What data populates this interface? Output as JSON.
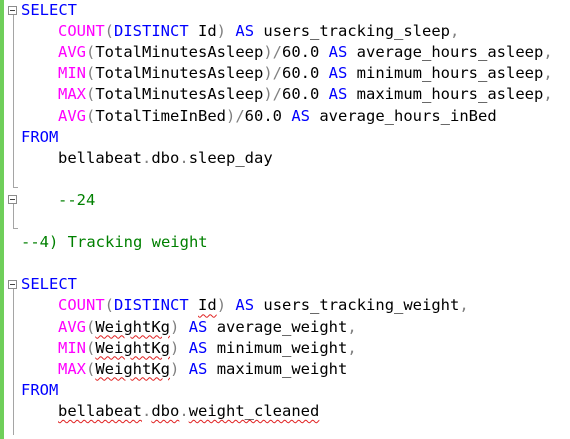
{
  "editor": {
    "lines": [
      {
        "t": [
          [
            "kw",
            "SELECT"
          ]
        ]
      },
      {
        "t": [
          [
            "fn",
            "COUNT"
          ],
          [
            "op",
            "("
          ],
          [
            "kw",
            "DISTINCT"
          ],
          [
            "tx",
            " Id"
          ],
          [
            "op",
            ")"
          ],
          [
            "tx",
            " "
          ],
          [
            "kw",
            "AS"
          ],
          [
            "tx",
            " users_tracking_sleep"
          ],
          [
            "op",
            ","
          ]
        ]
      },
      {
        "t": [
          [
            "fn",
            "AVG"
          ],
          [
            "op",
            "("
          ],
          [
            "tx",
            "TotalMinutesAsleep"
          ],
          [
            "op",
            ")/"
          ],
          [
            "tx",
            "60.0 "
          ],
          [
            "kw",
            "AS"
          ],
          [
            "tx",
            " average_hours_asleep"
          ],
          [
            "op",
            ","
          ]
        ]
      },
      {
        "t": [
          [
            "fn",
            "MIN"
          ],
          [
            "op",
            "("
          ],
          [
            "tx",
            "TotalMinutesAsleep"
          ],
          [
            "op",
            ")/"
          ],
          [
            "tx",
            "60.0 "
          ],
          [
            "kw",
            "AS"
          ],
          [
            "tx",
            " minimum_hours_asleep"
          ],
          [
            "op",
            ","
          ]
        ]
      },
      {
        "t": [
          [
            "fn",
            "MAX"
          ],
          [
            "op",
            "("
          ],
          [
            "tx",
            "TotalMinutesAsleep"
          ],
          [
            "op",
            ")/"
          ],
          [
            "tx",
            "60.0 "
          ],
          [
            "kw",
            "AS"
          ],
          [
            "tx",
            " maximum_hours_asleep"
          ],
          [
            "op",
            ","
          ]
        ]
      },
      {
        "t": [
          [
            "fn",
            "AVG"
          ],
          [
            "op",
            "("
          ],
          [
            "tx",
            "TotalTimeInBed"
          ],
          [
            "op",
            ")/"
          ],
          [
            "tx",
            "60.0 "
          ],
          [
            "kw",
            "AS"
          ],
          [
            "tx",
            " average_hours_inBed"
          ]
        ]
      },
      {
        "t": [
          [
            "kw",
            "FROM"
          ]
        ]
      },
      {
        "t": [
          [
            "tx",
            "bellabeat"
          ],
          [
            "op",
            "."
          ],
          [
            "tx",
            "dbo"
          ],
          [
            "op",
            "."
          ],
          [
            "tx",
            "sleep_day"
          ]
        ]
      },
      {
        "t": []
      },
      {
        "t": [
          [
            "cm",
            "--24"
          ]
        ]
      },
      {
        "t": []
      },
      {
        "t": [
          [
            "cm",
            "--4) Tracking weight"
          ]
        ]
      },
      {
        "t": []
      },
      {
        "t": [
          [
            "kw",
            "SELECT"
          ]
        ]
      },
      {
        "t": [
          [
            "fn",
            "COUNT"
          ],
          [
            "op",
            "("
          ],
          [
            "kw",
            "DISTINCT"
          ],
          [
            "tx",
            " "
          ],
          [
            "sq",
            "Id"
          ],
          [
            "op",
            ")"
          ],
          [
            "tx",
            " "
          ],
          [
            "kw",
            "AS"
          ],
          [
            "tx",
            " users_tracking_weight"
          ],
          [
            "op",
            ","
          ]
        ]
      },
      {
        "t": [
          [
            "fn",
            "AVG"
          ],
          [
            "op",
            "("
          ],
          [
            "sq",
            "WeightKg"
          ],
          [
            "op",
            ")"
          ],
          [
            "tx",
            " "
          ],
          [
            "kw",
            "AS"
          ],
          [
            "tx",
            " average_weight"
          ],
          [
            "op",
            ","
          ]
        ]
      },
      {
        "t": [
          [
            "fn",
            "MIN"
          ],
          [
            "op",
            "("
          ],
          [
            "sq",
            "WeightKg"
          ],
          [
            "op",
            ")"
          ],
          [
            "tx",
            " "
          ],
          [
            "kw",
            "AS"
          ],
          [
            "tx",
            " minimum_weight"
          ],
          [
            "op",
            ","
          ]
        ]
      },
      {
        "t": [
          [
            "fn",
            "MAX"
          ],
          [
            "op",
            "("
          ],
          [
            "sq",
            "WeightKg"
          ],
          [
            "op",
            ")"
          ],
          [
            "tx",
            " "
          ],
          [
            "kw",
            "AS"
          ],
          [
            "tx",
            " maximum_weight"
          ]
        ]
      },
      {
        "t": [
          [
            "kw",
            "FROM"
          ]
        ]
      },
      {
        "t": [
          [
            "sq",
            "bellabeat"
          ],
          [
            "op",
            "."
          ],
          [
            "sq",
            "dbo"
          ],
          [
            "op",
            "."
          ],
          [
            "sq",
            "weight_cleaned"
          ]
        ]
      }
    ]
  },
  "colors": {
    "keyword": "#0000ff",
    "function": "#ff00ff",
    "operator": "#808080",
    "comment": "#008000",
    "change_margin": "#6fcf5a",
    "squiggle": "#e02020"
  }
}
